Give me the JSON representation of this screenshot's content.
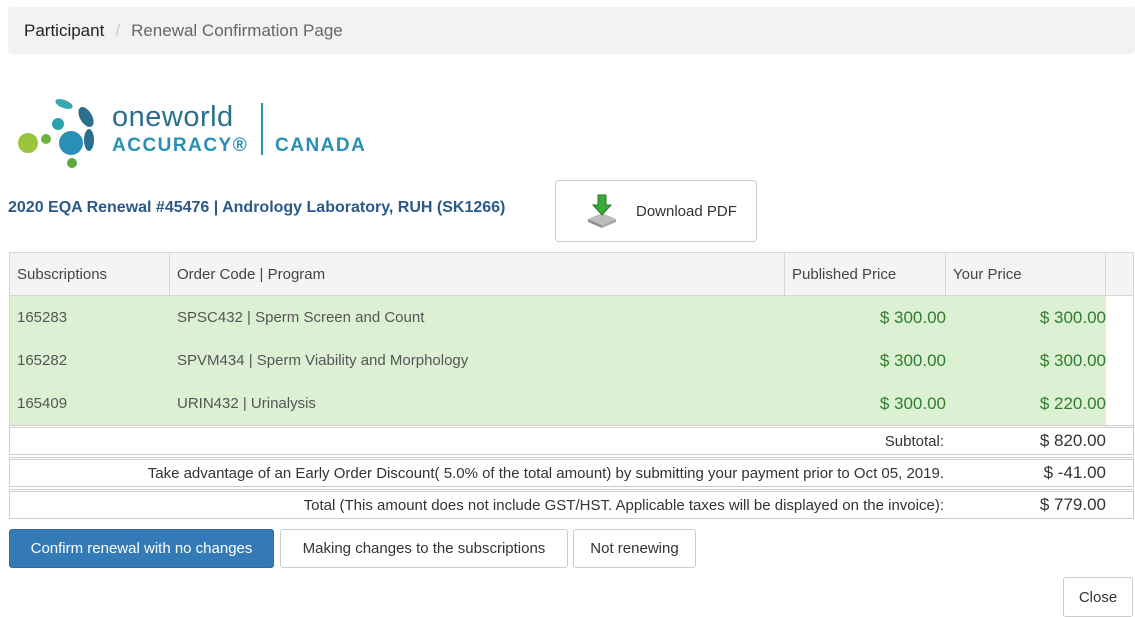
{
  "breadcrumb": {
    "first": "Participant",
    "separator": "/",
    "active": "Renewal Confirmation Page"
  },
  "logo": {
    "line1": "oneworld",
    "line2": "ACCURACY®",
    "line3": "CANADA"
  },
  "renewal": {
    "title": "2020 EQA Renewal #45476 | Andrology Laboratory, RUH (SK1266)",
    "download_label": "Download PDF"
  },
  "table": {
    "headers": [
      "Subscriptions",
      "Order Code | Program",
      "Published Price",
      "Your Price"
    ],
    "rows": [
      {
        "subscription": "165283",
        "program": "SPSC432 | Sperm Screen and Count",
        "published": "$ 300.00",
        "your": "$ 300.00"
      },
      {
        "subscription": "165282",
        "program": "SPVM434 | Sperm Viability and Morphology",
        "published": "$ 300.00",
        "your": "$ 300.00"
      },
      {
        "subscription": "165409",
        "program": "URIN432 | Urinalysis",
        "published": "$ 300.00",
        "your": "$ 220.00"
      }
    ]
  },
  "summary": {
    "subtotal_label": "Subtotal:",
    "subtotal": "$ 820.00",
    "discount_label": "Take advantage of an Early Order Discount( 5.0% of the total amount) by submitting your payment prior to Oct 05, 2019.",
    "discount": "$ -41.00",
    "total_label": "Total (This amount does not include GST/HST. Applicable taxes will be displayed on the invoice):",
    "total": "$ 779.00"
  },
  "actions": {
    "confirm": "Confirm renewal with no changes",
    "changes": "Making changes to the subscriptions",
    "not_renewing": "Not renewing",
    "close": "Close"
  },
  "colors": {
    "primary": "#337ab7",
    "row_bg": "#dcf1d4",
    "price_green": "#2e7d2e",
    "title_blue": "#2b5a8a"
  }
}
